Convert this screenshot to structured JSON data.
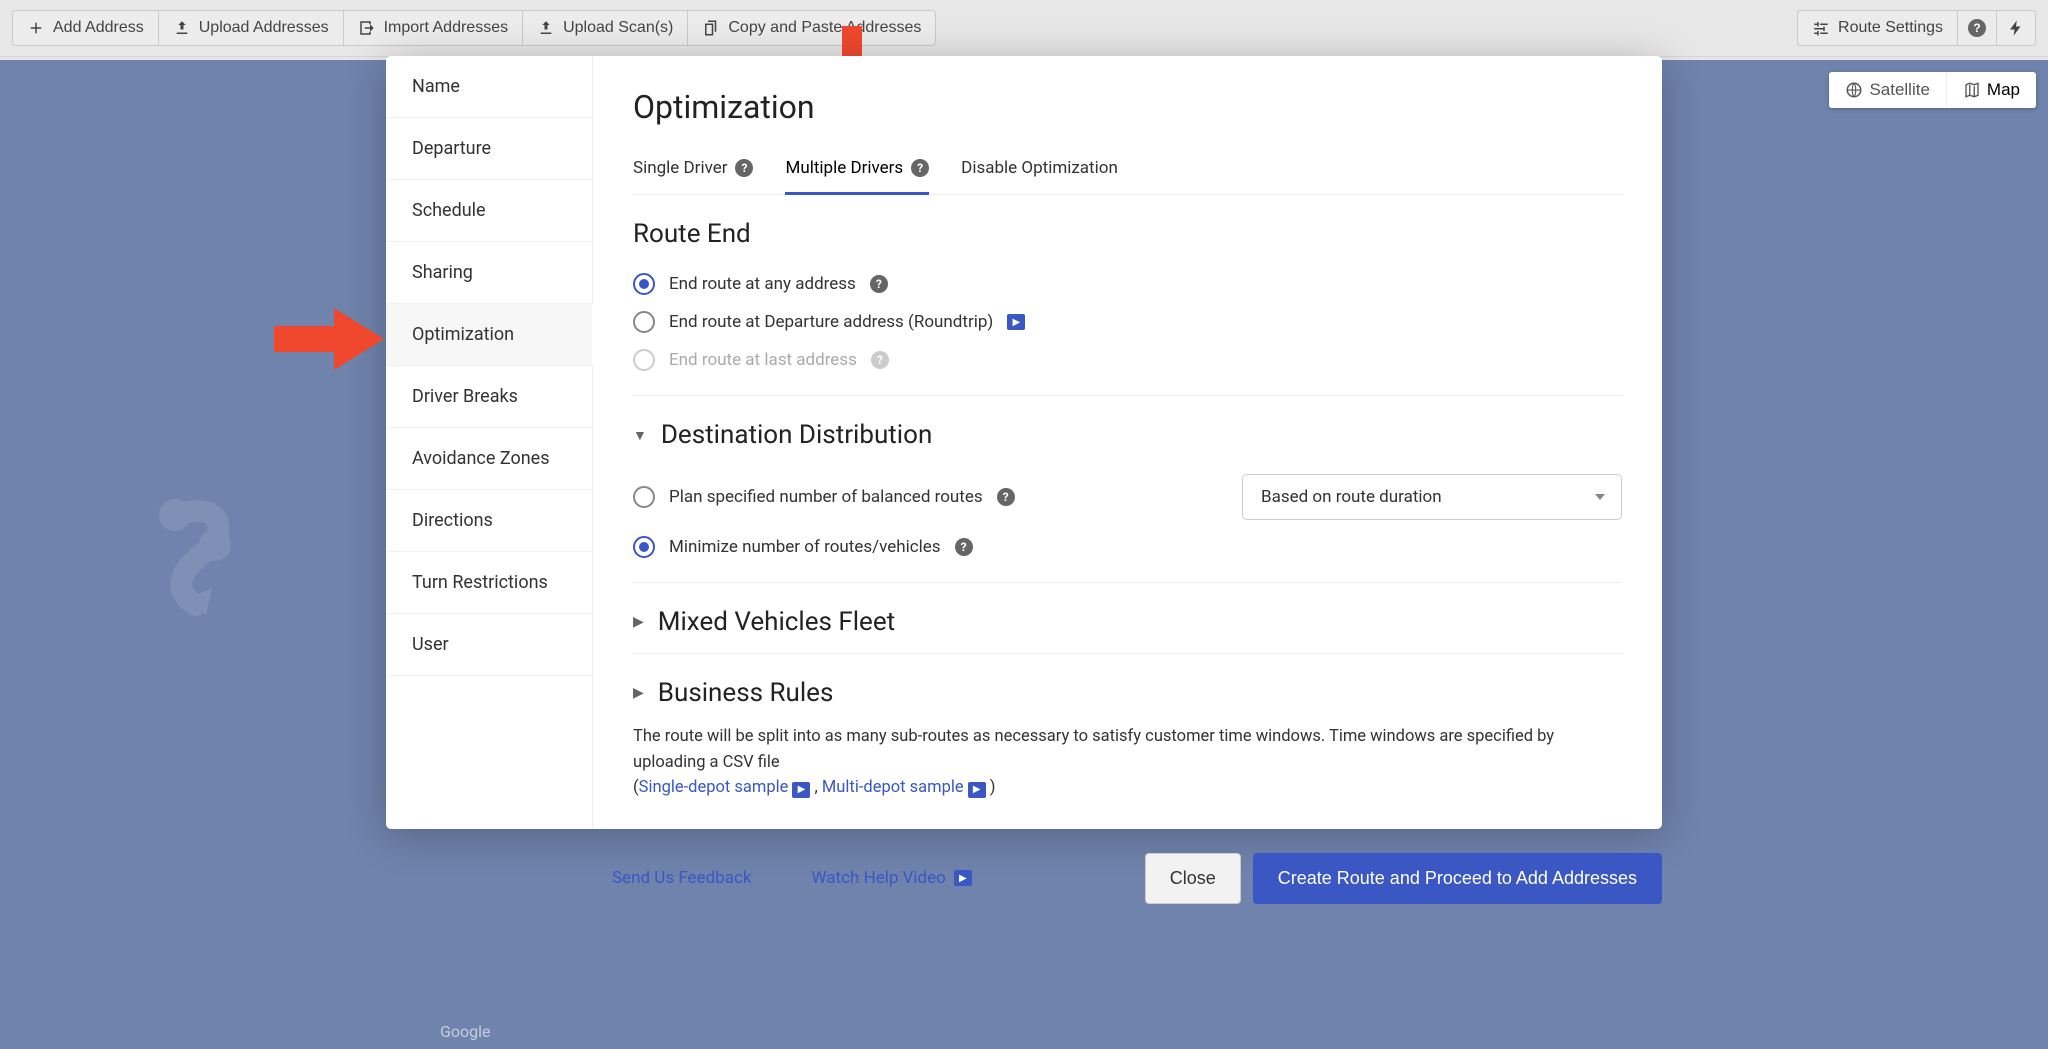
{
  "toolbar": {
    "add_address": "Add Address",
    "upload_addresses": "Upload Addresses",
    "import_addresses": "Import Addresses",
    "upload_scans": "Upload Scan(s)",
    "copy_paste": "Copy and Paste Addresses",
    "route_settings": "Route Settings"
  },
  "map": {
    "satellite": "Satellite",
    "map": "Map",
    "attribution": "Google"
  },
  "sidebar": {
    "items": [
      {
        "label": "Name"
      },
      {
        "label": "Departure"
      },
      {
        "label": "Schedule"
      },
      {
        "label": "Sharing"
      },
      {
        "label": "Optimization"
      },
      {
        "label": "Driver Breaks"
      },
      {
        "label": "Avoidance Zones"
      },
      {
        "label": "Directions"
      },
      {
        "label": "Turn Restrictions"
      },
      {
        "label": "User"
      }
    ],
    "selected_index": 4
  },
  "panel": {
    "heading": "Optimization",
    "tabs": {
      "single": "Single Driver",
      "multiple": "Multiple Drivers",
      "disable": "Disable Optimization",
      "active_index": 1
    },
    "route_end": {
      "title": "Route End",
      "opt_any": "End route at any address",
      "opt_roundtrip": "End route at Departure address (Roundtrip)",
      "opt_last": "End route at last address",
      "selected": "any",
      "last_disabled": true
    },
    "dest_dist": {
      "title": "Destination Distribution",
      "opt_balanced": "Plan specified number of balanced routes",
      "opt_minimize": "Minimize number of routes/vehicles",
      "selected": "minimize",
      "dropdown_label": "Based on route duration"
    },
    "mixed_fleet_title": "Mixed Vehicles Fleet",
    "business_rules_title": "Business Rules",
    "info_text_1": "The route will be split into as many sub-routes as necessary to satisfy customer time windows. Time windows are specified by uploading a CSV file",
    "link_single": "Single-depot sample",
    "link_multi": "Multi-depot sample"
  },
  "footer": {
    "feedback": "Send Us Feedback",
    "watch_video": "Watch Help Video",
    "close": "Close",
    "create": "Create Route and Proceed to Add Addresses"
  }
}
